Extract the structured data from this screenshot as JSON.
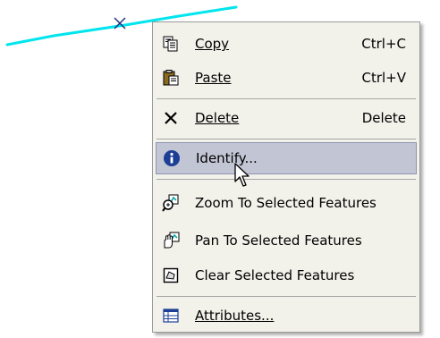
{
  "menu": {
    "items": [
      {
        "label": "Copy",
        "shortcut": "Ctrl+C",
        "icon": "copy-icon"
      },
      {
        "label": "Paste",
        "shortcut": "Ctrl+V",
        "icon": "paste-icon"
      },
      {
        "label": "Delete",
        "shortcut": "Delete",
        "icon": "delete-icon"
      },
      {
        "label": "Identify...",
        "shortcut": "",
        "icon": "info-icon",
        "highlighted": true
      },
      {
        "label": "Zoom To Selected Features",
        "shortcut": "",
        "icon": "zoom-to-selected-icon"
      },
      {
        "label": "Pan To Selected Features",
        "shortcut": "",
        "icon": "pan-to-selected-icon"
      },
      {
        "label": "Clear Selected Features",
        "shortcut": "",
        "icon": "clear-selection-icon"
      },
      {
        "label": "Attributes...",
        "shortcut": "",
        "icon": "attributes-table-icon"
      }
    ]
  },
  "colors": {
    "selected_line": "#00e5ee",
    "vertex_marker": "#1a2a7a",
    "menu_background": "#f2f1ea",
    "highlight_background": "#c2c5d4",
    "highlight_border": "#8f95b3"
  }
}
